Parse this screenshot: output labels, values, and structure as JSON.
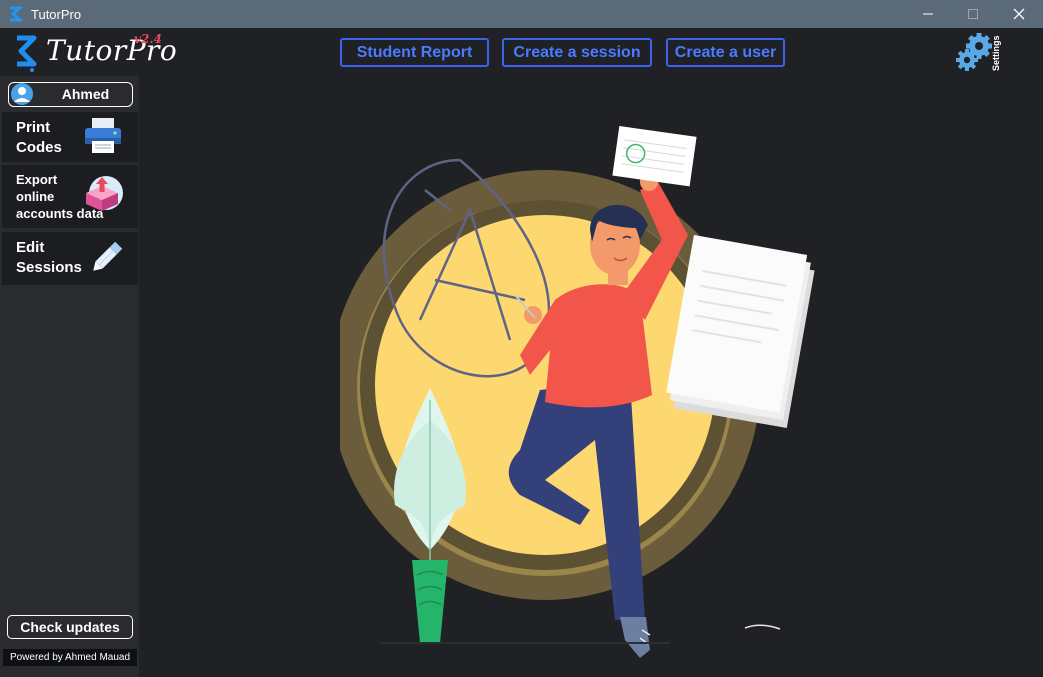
{
  "window": {
    "title": "TutorPro"
  },
  "header": {
    "logo_text": "TutorPro",
    "version": "v2.4",
    "nav": [
      {
        "label": "Student Report"
      },
      {
        "label": "Create a session"
      },
      {
        "label": "Create a user"
      }
    ],
    "settings_label": "Settings"
  },
  "sidebar": {
    "user_name": "Ahmed",
    "items": [
      {
        "label": "Print\nCodes",
        "icon": "printer-icon"
      },
      {
        "label": "Export\nonline\naccounts data",
        "icon": "export-box-icon"
      },
      {
        "label": "Edit\nSessions",
        "icon": "pencil-icon"
      }
    ],
    "check_updates_label": "Check updates",
    "powered_by": "Powered by Ahmed Mauad"
  },
  "colors": {
    "accent": "#3b63f0",
    "titlebar": "#5b6a78",
    "background": "#202124",
    "sidebar": "#2a2b2e",
    "sun": "#fdd870",
    "shirt": "#f2564b",
    "pants": "#33407a"
  }
}
